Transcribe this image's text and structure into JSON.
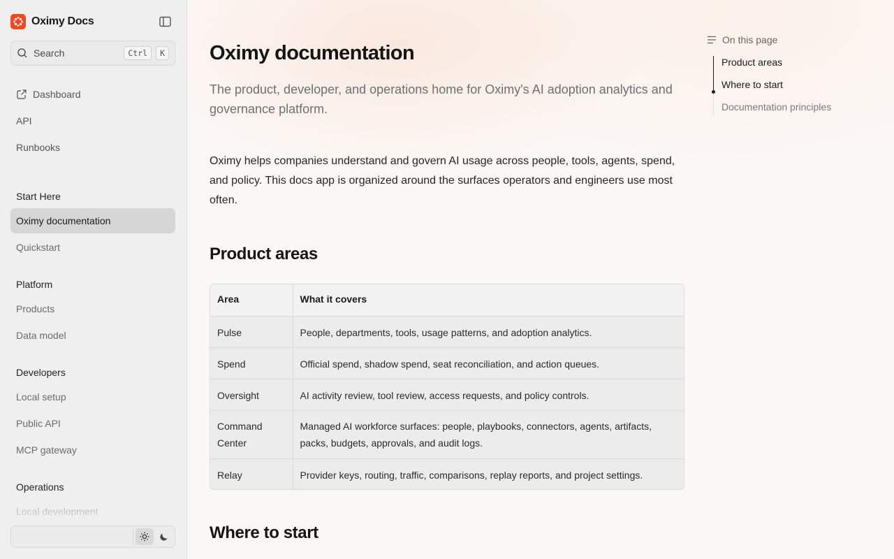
{
  "brand": {
    "name": "Oximy Docs"
  },
  "search": {
    "label": "Search",
    "shortcut_key1": "Ctrl",
    "shortcut_key2": "K"
  },
  "top_links": [
    {
      "label": "Dashboard",
      "icon": "external-link-icon"
    },
    {
      "label": "API"
    },
    {
      "label": "Runbooks"
    }
  ],
  "sections": {
    "start_here": {
      "title": "Start Here",
      "items": [
        "Oximy documentation",
        "Quickstart"
      ],
      "active": "Oximy documentation"
    },
    "platform": {
      "title": "Platform",
      "items": [
        "Products",
        "Data model"
      ]
    },
    "developers": {
      "title": "Developers",
      "items": [
        "Local setup",
        "Public API",
        "MCP gateway"
      ]
    },
    "operations": {
      "title": "Operations",
      "items": [
        "Local development"
      ]
    }
  },
  "page": {
    "title": "Oximy documentation",
    "subtitle": "The product, developer, and operations home for Oximy's AI adoption analytics and governance platform.",
    "intro": "Oximy helps companies understand and govern AI usage across people, tools, agents, spend, and policy. This docs app is organized around the surfaces operators and engineers use most often.",
    "h2_product_areas": "Product areas",
    "h2_where_to_start": "Where to start"
  },
  "table": {
    "headers": [
      "Area",
      "What it covers"
    ],
    "rows": [
      [
        "Pulse",
        "People, departments, tools, usage patterns, and adoption analytics."
      ],
      [
        "Spend",
        "Official spend, shadow spend, seat reconciliation, and action queues."
      ],
      [
        "Oversight",
        "AI activity review, tool review, access requests, and policy controls."
      ],
      [
        "Command Center",
        "Managed AI workforce surfaces: people, playbooks, connectors, agents, artifacts, packs, budgets, approvals, and audit logs."
      ],
      [
        "Relay",
        "Provider keys, routing, traffic, comparisons, replay reports, and project settings."
      ]
    ]
  },
  "toc": {
    "title": "On this page",
    "items": [
      "Product areas",
      "Where to start",
      "Documentation principles"
    ]
  },
  "theme": {
    "active": "light"
  },
  "colors": {
    "brand": "#f04a1e",
    "sidebar_bg": "#efefef",
    "active_item_bg": "#d6d6d6"
  }
}
